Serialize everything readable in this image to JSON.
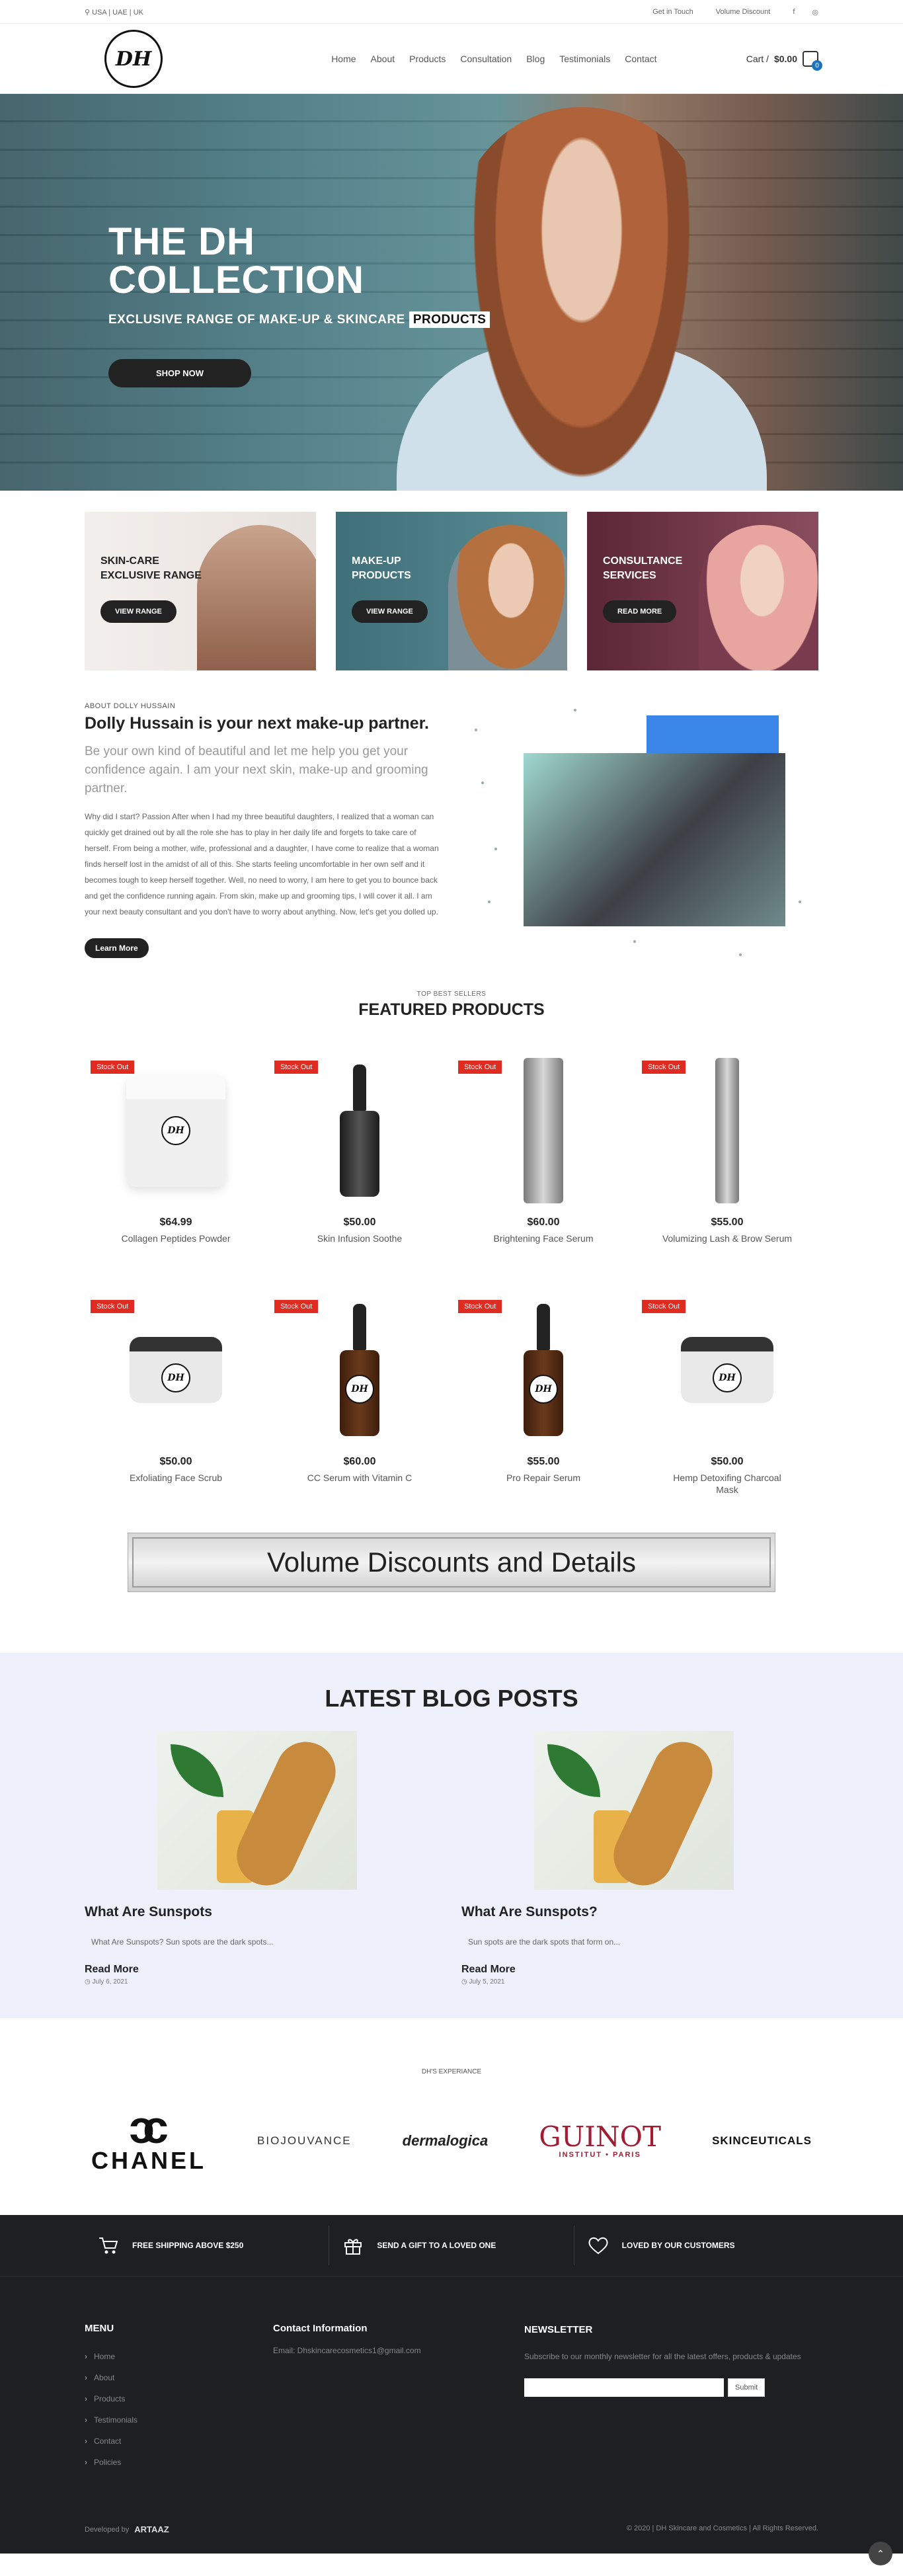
{
  "topbar": {
    "regions": "USA | UAE | UK",
    "get_in_touch": "Get in Touch",
    "volume_discount": "Volume Discount",
    "facebook_icon": "f",
    "instagram_icon": "◎"
  },
  "header": {
    "logo": "DH",
    "nav": [
      "Home",
      "About",
      "Products",
      "Consultation",
      "Blog",
      "Testimonials",
      "Contact"
    ],
    "cart_label": "Cart /",
    "cart_total": "$0.00",
    "cart_count": "0"
  },
  "hero": {
    "title_line1": "THE DH",
    "title_line2": "COLLECTION",
    "subtitle": "EXCLUSIVE RANGE OF MAKE-UP & SKINCARE",
    "subtitle_highlight": "PRODUCTS",
    "button": "SHOP NOW"
  },
  "categories": [
    {
      "line1": "SKIN-CARE",
      "line2": "EXCLUSIVE RANGE",
      "button": "VIEW RANGE",
      "color": "#d9d2cf"
    },
    {
      "line1": "MAKE-UP",
      "line2": "PRODUCTS",
      "button": "VIEW RANGE",
      "color": "#4b7f88"
    },
    {
      "line1": "CONSULTANCE",
      "line2": "SERVICES",
      "button": "READ MORE",
      "color": "#7a3b4e"
    }
  ],
  "about": {
    "kicker": "ABOUT DOLLY HUSSAIN",
    "title": "Dolly Hussain is your next make-up partner.",
    "lead": "Be your own kind of beautiful and let me help you get your confidence again. I am your next skin, make-up and grooming partner.",
    "body": "Why did I start? Passion After when I had my three beautiful daughters, I realized that a woman can quickly get drained out by all the role she has to play in her daily life and forgets to take care of herself. From being a mother, wife, professional and a daughter, I have come to realize that a woman finds herself lost in the amidst of all of this. She starts feeling uncomfortable in her own self and it becomes tough to keep herself together. Well, no need to worry, I am here to get you to bounce back and get the confidence running again. From skin, make up and grooming tips, I will cover it all. I am your next beauty consultant and you don't have to worry about anything. Now, let's get you dolled up.",
    "button": "Learn More"
  },
  "featured": {
    "kicker": "TOP BEST SELLERS",
    "title": "FEATURED PRODUCTS",
    "badge": "Stock Out",
    "products": [
      {
        "price": "$64.99",
        "name": "Collagen Peptides Powder",
        "kind": "whitejar"
      },
      {
        "price": "$50.00",
        "name": "Skin Infusion Soothe",
        "kind": "dropper"
      },
      {
        "price": "$60.00",
        "name": "Brightening Face Serum",
        "kind": "tube"
      },
      {
        "price": "$55.00",
        "name": "Volumizing Lash & Brow Serum",
        "kind": "slimtube"
      },
      {
        "price": "$50.00",
        "name": "Exfoliating Face Scrub",
        "kind": "jar"
      },
      {
        "price": "$60.00",
        "name": "CC Serum with Vitamin C",
        "kind": "amber"
      },
      {
        "price": "$55.00",
        "name": "Pro Repair Serum",
        "kind": "amber"
      },
      {
        "price": "$50.00",
        "name": "Hemp Detoxifing Charcoal Mask",
        "kind": "jar"
      }
    ]
  },
  "volume_banner": "Volume Discounts and Details",
  "blog": {
    "title": "LATEST BLOG POSTS",
    "posts": [
      {
        "title": "What Are Sunspots",
        "excerpt": "What Are Sunspots? Sun spots are the dark spots...",
        "more": "Read More",
        "date": "July 6, 2021"
      },
      {
        "title": "What Are Sunspots?",
        "excerpt": "Sun spots are the dark spots that form on...",
        "more": "Read More",
        "date": "July 5, 2021"
      }
    ]
  },
  "brands": {
    "kicker": "DH'S EXPERIANCE",
    "chanel": "CHANEL",
    "biojouvance": "BIOJOUVANCE",
    "dermalogica": "dermalogica",
    "guinot": "GUINOT",
    "guinot_sub": "INSTITUT • PARIS",
    "skinceuticals": "SKINCEUTICALS"
  },
  "features": [
    {
      "icon": "cart-icon",
      "text": "FREE SHIPPING ABOVE $250"
    },
    {
      "icon": "gift-icon",
      "text": "SEND A GIFT TO A LOVED ONE"
    },
    {
      "icon": "heart-icon",
      "text": "LOVED BY OUR CUSTOMERS"
    }
  ],
  "footer": {
    "menu_title": "MENU",
    "menu": [
      "Home",
      "About",
      "Products",
      "Testimonials",
      "Contact",
      "Policies"
    ],
    "contact_title": "Contact Information",
    "email": "Email: Dhskincarecosmetics1@gmail.com",
    "news_title": "NEWSLETTER",
    "news_text": "Subscribe to our monthly newsletter for all the latest offers, products & updates",
    "submit": "Submit",
    "developed_by": "Developed by",
    "developer": "ARTAAZ",
    "copyright": "© 2020 | DH Skincare and Cosmetics | All Rights Reserved."
  }
}
